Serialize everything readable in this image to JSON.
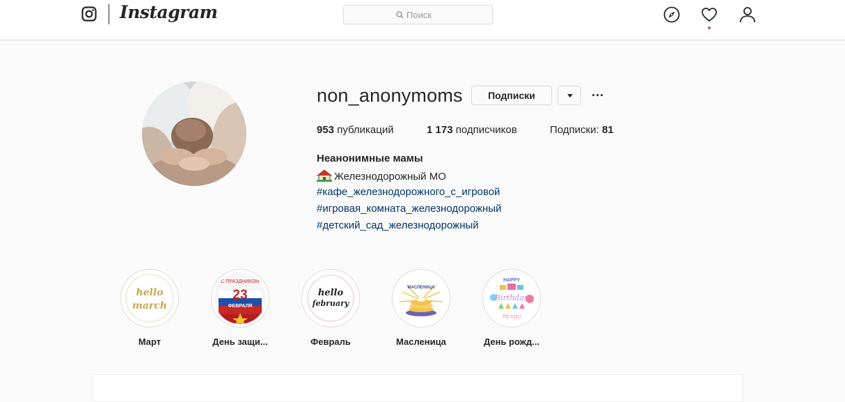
{
  "header": {
    "brand": "Instagram",
    "search_placeholder": "Поиск",
    "icons": [
      "instagram-glyph-icon",
      "compass-icon",
      "heart-icon",
      "user-icon",
      "search-icon"
    ],
    "notification_dot_color": "#ed4956"
  },
  "profile": {
    "username": "non_anonymoms",
    "follow_button": "Подписки",
    "stats": {
      "posts_count": "953",
      "posts_label": "публикаций",
      "followers_count": "1 173",
      "followers_label": "подписчиков",
      "following_label": "Подписки:",
      "following_count": "81"
    },
    "full_name": "Неанонимные мамы",
    "location": "Железнодорожный МО",
    "hashtags": [
      "#кафе_железнодорожного_с_игровой",
      "#игровая_комната_железнодорожный",
      "#детский_сад_железнодорожный"
    ],
    "hashtag_color": "#003569"
  },
  "highlights": [
    {
      "label": "Март",
      "art_text": [
        "hello",
        "march"
      ]
    },
    {
      "label": "День защи...",
      "art_text": [
        "С ПРАЗДНИКОМ",
        "23",
        "ФЕВРАЛЯ"
      ]
    },
    {
      "label": "Февраль",
      "art_text": [
        "hello",
        "february"
      ]
    },
    {
      "label": "Масленица",
      "art_text": [
        "МАСЛЕНИЦА"
      ]
    },
    {
      "label": "День рожд...",
      "art_text": [
        "HAPPY",
        "Birthday",
        "TO YOU"
      ]
    }
  ]
}
